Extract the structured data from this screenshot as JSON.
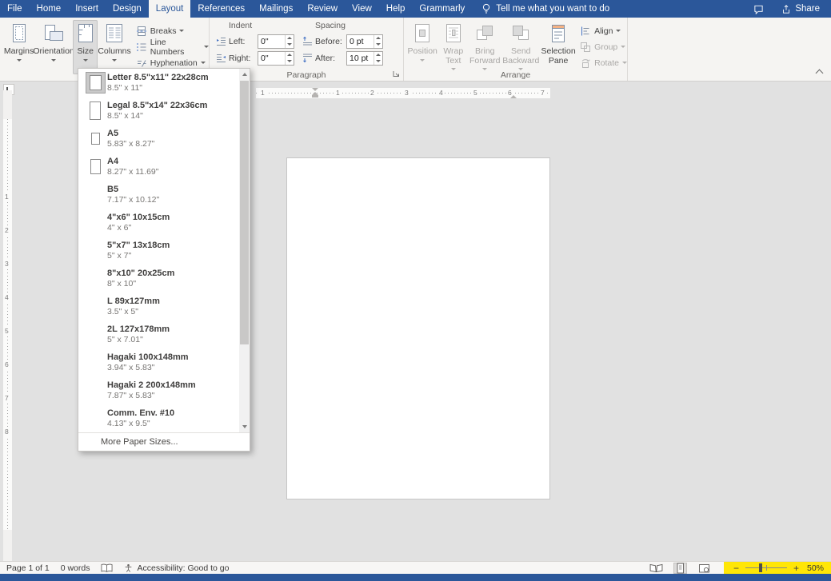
{
  "tabs": {
    "items": [
      "File",
      "Home",
      "Insert",
      "Design",
      "Layout",
      "References",
      "Mailings",
      "Review",
      "View",
      "Help",
      "Grammarly"
    ],
    "active": "Layout"
  },
  "tellme": {
    "label": "Tell me what you want to do"
  },
  "titlebar_right": {
    "share": "Share"
  },
  "ribbon": {
    "page_setup": {
      "margins": "Margins",
      "orientation": "Orientation",
      "size": "Size",
      "columns": "Columns",
      "breaks": "Breaks",
      "line_numbers": "Line Numbers",
      "hyphenation": "Hyphenation"
    },
    "paragraph": {
      "group_label": "Paragraph",
      "indent_header": "Indent",
      "spacing_header": "Spacing",
      "left_label": "Left:",
      "left_value": "0\"",
      "right_label": "Right:",
      "right_value": "0\"",
      "before_label": "Before:",
      "before_value": "0 pt",
      "after_label": "After:",
      "after_value": "10 pt"
    },
    "arrange": {
      "group_label": "Arrange",
      "position": "Position",
      "wrap_text": "Wrap Text",
      "bring_forward": "Bring Forward",
      "send_backward": "Send Backward",
      "selection_pane": "Selection Pane",
      "align": "Align",
      "group": "Group",
      "rotate": "Rotate"
    }
  },
  "size_dropdown": {
    "items": [
      {
        "name": "Letter 8.5\"x11\" 22x28cm",
        "dims": "8.5\" x 11\"",
        "selected": true,
        "has_icon": true
      },
      {
        "name": "Legal 8.5\"x14\" 22x36cm",
        "dims": "8.5\" x 14\"",
        "has_icon": true
      },
      {
        "name": "A5",
        "dims": "5.83\" x 8.27\"",
        "has_icon": true
      },
      {
        "name": "A4",
        "dims": "8.27\" x 11.69\"",
        "has_icon": true
      },
      {
        "name": "B5",
        "dims": "7.17\" x 10.12\""
      },
      {
        "name": "4\"x6\" 10x15cm",
        "dims": "4\" x 6\""
      },
      {
        "name": "5\"x7\" 13x18cm",
        "dims": "5\" x 7\""
      },
      {
        "name": "8\"x10\" 20x25cm",
        "dims": "8\" x 10\""
      },
      {
        "name": "L 89x127mm",
        "dims": "3.5\" x 5\""
      },
      {
        "name": "2L 127x178mm",
        "dims": "5\" x 7.01\""
      },
      {
        "name": "Hagaki 100x148mm",
        "dims": "3.94\" x 5.83\""
      },
      {
        "name": "Hagaki 2 200x148mm",
        "dims": "7.87\" x 5.83\""
      },
      {
        "name": "Comm. Env. #10",
        "dims": "4.13\" x 9.5\""
      }
    ],
    "footer": "More Paper Sizes..."
  },
  "ruler": {
    "h_pre": "1",
    "h_numbers": [
      "1",
      "2",
      "3",
      "4",
      "5",
      "6",
      "7"
    ],
    "v_numbers": [
      "1",
      "2",
      "3",
      "4",
      "5",
      "6",
      "7",
      "8"
    ]
  },
  "statusbar": {
    "page_indicator": "Page 1 of 1",
    "word_count": "0 words",
    "accessibility": "Accessibility: Good to go",
    "zoom_level": "50%"
  },
  "colors": {
    "accent_blue": "#2b579a",
    "zoom_highlight": "#ffe606",
    "selection_pane_orange": "#f4b183"
  }
}
